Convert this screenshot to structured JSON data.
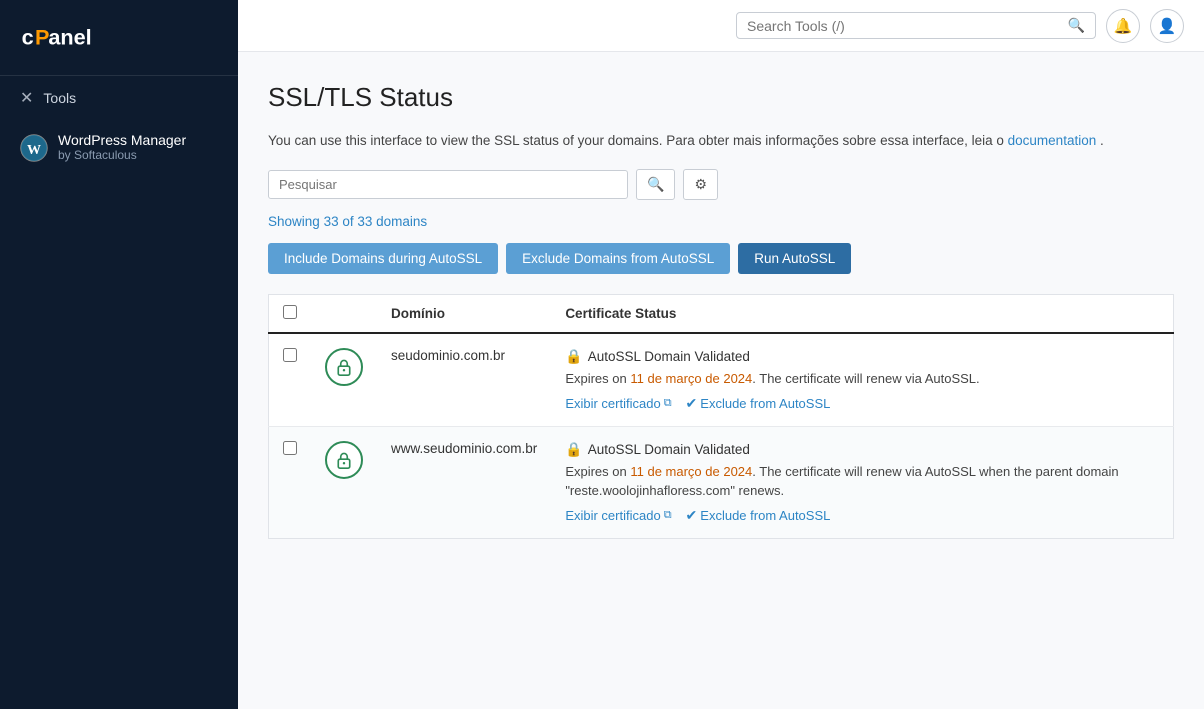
{
  "sidebar": {
    "logo_text": "cPanel",
    "tools_item": {
      "label": "Tools",
      "icon": "✕"
    },
    "wp_manager": {
      "name": "WordPress Manager",
      "subtitle": "by Softaculous"
    }
  },
  "topbar": {
    "search_placeholder": "Search Tools (/)",
    "notification_icon": "bell",
    "user_icon": "user"
  },
  "page": {
    "title": "SSL/TLS Status",
    "description": "You can use this interface to view the SSL status of your domains. Para obter mais informações sobre essa interface, leia o",
    "doc_link_text": "documentation",
    "description_end": ".",
    "filter_placeholder": "Pesquisar",
    "showing_text": "Showing",
    "showing_count": "33 of 33",
    "showing_suffix": "domains",
    "buttons": {
      "include": "Include Domains during AutoSSL",
      "exclude": "Exclude Domains from AutoSSL",
      "run": "Run AutoSSL"
    },
    "table": {
      "col_domain": "Domínio",
      "col_cert": "Certificate Status"
    },
    "rows": [
      {
        "domain": "seudominio.com.br",
        "cert_title": "AutoSSL Domain Validated",
        "expires_prefix": "Expires on",
        "expires_date": "11 de março de 2024",
        "expires_suffix": ". The certificate will renew via AutoSSL.",
        "link_view": "Exibir certificado",
        "link_exclude": "Exclude from AutoSSL"
      },
      {
        "domain": "www.seudominio.com.br",
        "cert_title": "AutoSSL Domain Validated",
        "expires_prefix": "Expires on",
        "expires_date": "11 de março de 2024",
        "expires_suffix": ". The certificate will renew via AutoSSL when the parent domain \"reste.woolojinhafloress.com\" renews.",
        "link_view": "Exibir certificado",
        "link_exclude": "Exclude from AutoSSL"
      }
    ]
  }
}
